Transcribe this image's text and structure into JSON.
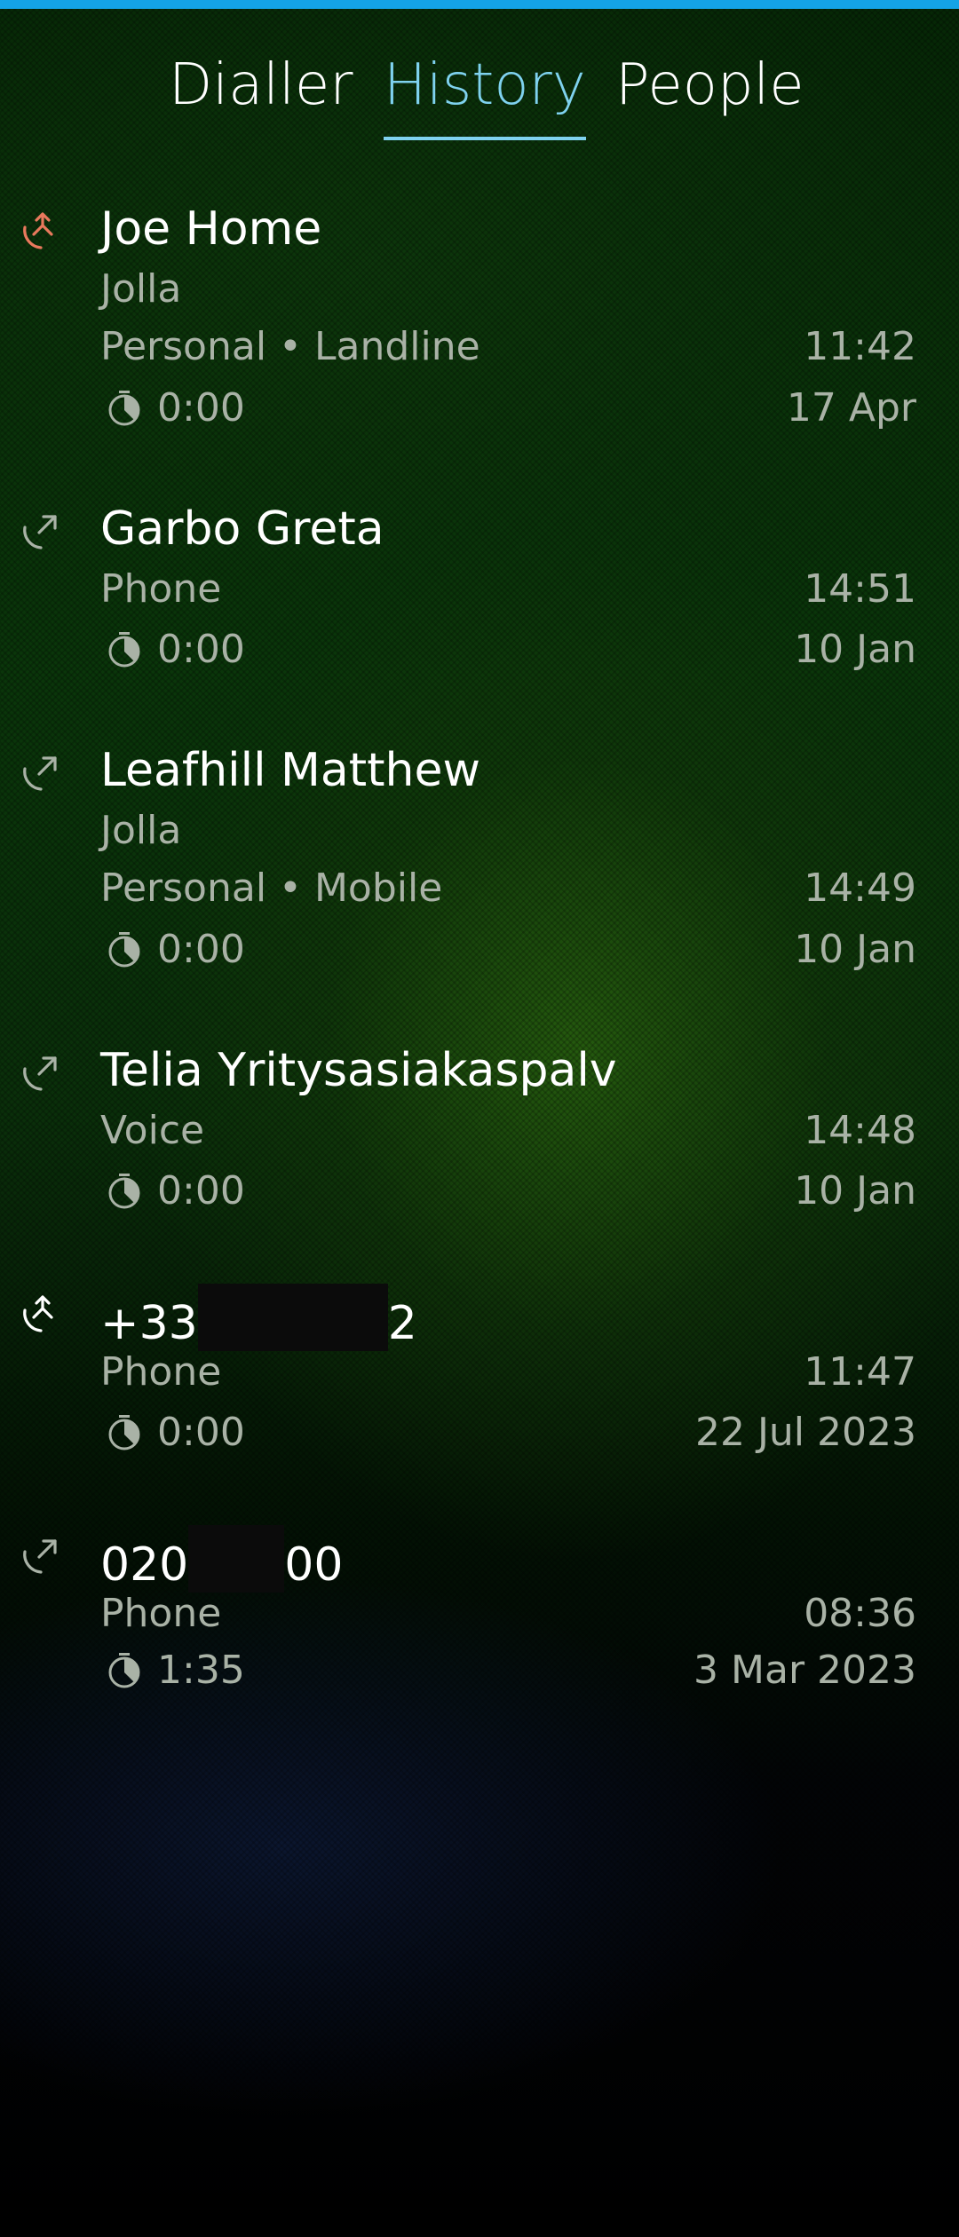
{
  "header": {
    "accent_color": "#14a3e6",
    "tabs": [
      {
        "label": "Dialler",
        "active": false
      },
      {
        "label": "History",
        "active": true
      },
      {
        "label": "People",
        "active": false
      }
    ]
  },
  "calls": [
    {
      "direction_icon": "missed-call-icon",
      "name": "Joe Home",
      "org": "Jolla",
      "detail": "Personal • Landline",
      "time": "11:42",
      "duration": "0:00",
      "date": "17 Apr"
    },
    {
      "direction_icon": "outgoing-call-icon",
      "name": "Garbo Greta",
      "detail": "Phone",
      "time": "14:51",
      "duration": "0:00",
      "date": "10 Jan"
    },
    {
      "direction_icon": "outgoing-call-icon",
      "name": "Leafhill Matthew",
      "org": "Jolla",
      "detail": "Personal • Mobile",
      "time": "14:49",
      "duration": "0:00",
      "date": "10 Jan"
    },
    {
      "direction_icon": "outgoing-call-icon",
      "name": "Telia Yritysasiakaspalv",
      "detail": "Voice",
      "time": "14:48",
      "duration": "0:00",
      "date": "10 Jan"
    },
    {
      "direction_icon": "incoming-call-icon",
      "name_prefix": "+33",
      "name_suffix": "2",
      "detail": "Phone",
      "time": "11:47",
      "duration": "0:00",
      "date": "22 Jul 2023"
    },
    {
      "direction_icon": "outgoing-call-icon",
      "name_prefix": "020",
      "name_suffix": "00",
      "detail": "Phone",
      "time": "08:36",
      "duration": "1:35",
      "date": "3 Mar 2023"
    }
  ],
  "colors": {
    "active_tab": "#7fd2ef",
    "missed": "#e9795d"
  }
}
